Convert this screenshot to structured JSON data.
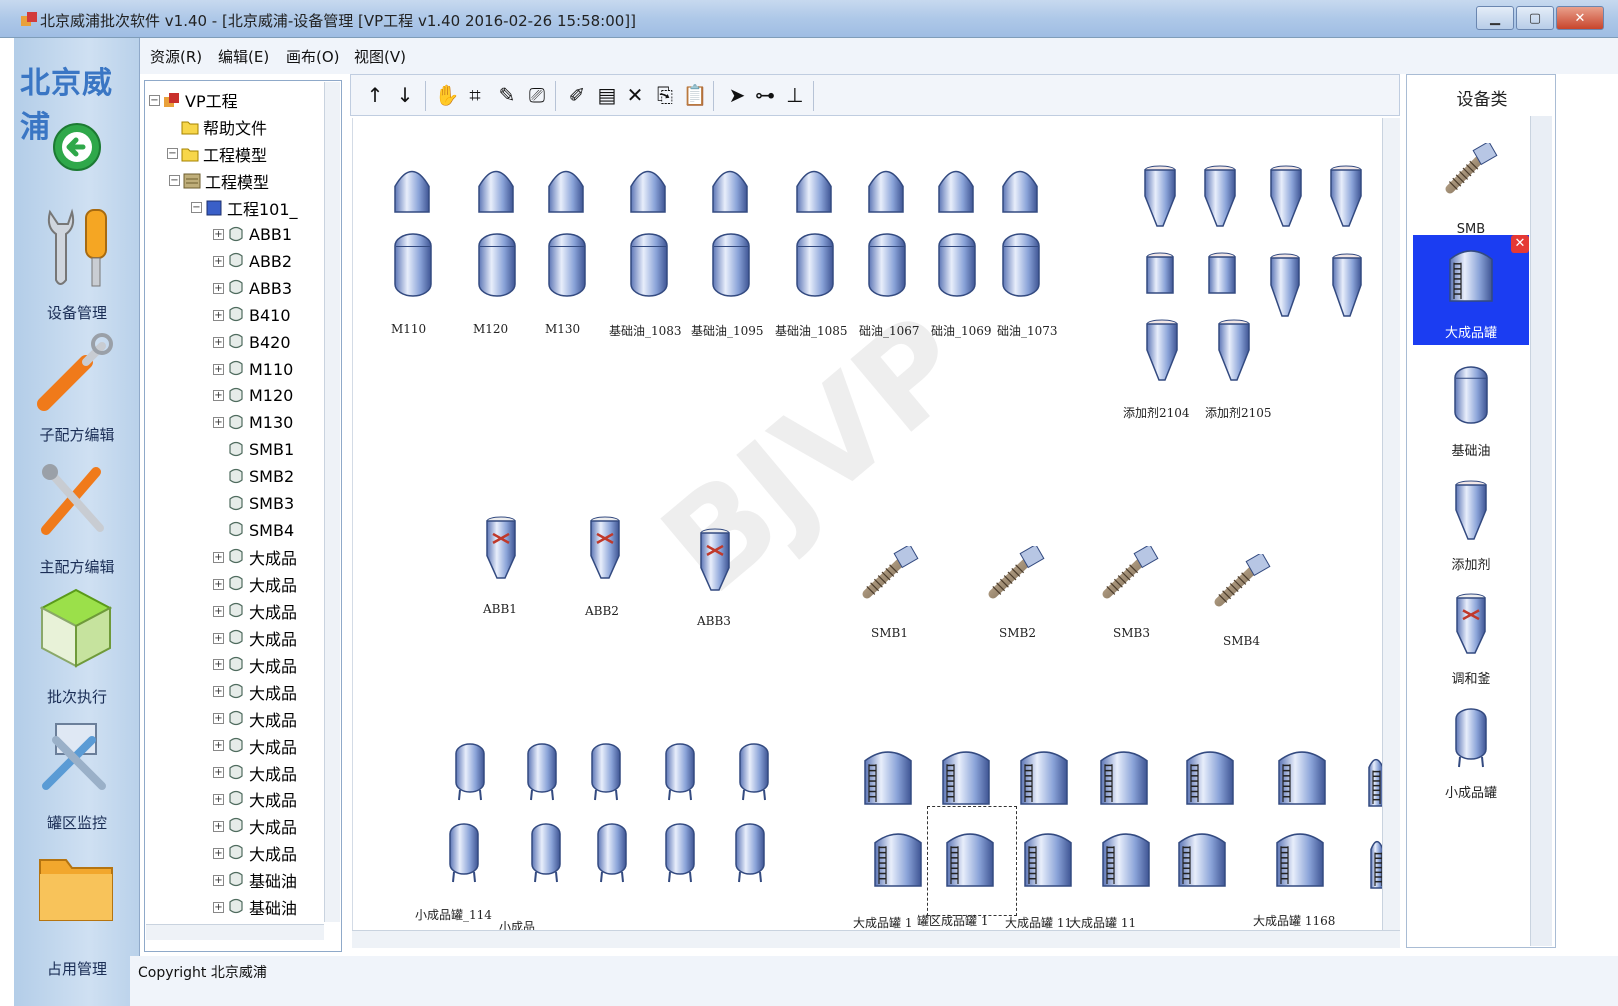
{
  "window": {
    "title": "北京威浦批次软件 v1.40 - [北京威浦-设备管理 [VP工程 v1.40 2016-02-26 15:58:00]]"
  },
  "menu": [
    {
      "label": "资源(R)"
    },
    {
      "label": "编辑(E)"
    },
    {
      "label": "画布(O)"
    },
    {
      "label": "视图(V)"
    }
  ],
  "sidebar": {
    "brand": "北京威浦",
    "items": [
      {
        "label": "设备管理",
        "icon": "wrench-screwdriver-icon"
      },
      {
        "label": "子配方编辑",
        "icon": "tools-icon"
      },
      {
        "label": "主配方编辑",
        "icon": "crossed-tools-icon"
      },
      {
        "label": "批次执行",
        "icon": "cubes-icon"
      },
      {
        "label": "罐区监控",
        "icon": "monitor-tools-icon"
      },
      {
        "label": "占用管理",
        "icon": "folder-icon"
      }
    ]
  },
  "tree": {
    "rows": [
      {
        "label": "VP工程",
        "level": 0,
        "exp": "⊟"
      },
      {
        "label": "帮助文件",
        "level": 1,
        "exp": ""
      },
      {
        "label": "工程模型",
        "level": 1,
        "exp": "⊟"
      },
      {
        "label": "工程模型",
        "level": 2,
        "exp": "⊟"
      },
      {
        "label": "工程101_",
        "level": 3,
        "exp": "⊟"
      },
      {
        "label": "ABB1",
        "level": 4,
        "exp": "⊞"
      },
      {
        "label": "ABB2",
        "level": 4,
        "exp": "⊞"
      },
      {
        "label": "ABB3",
        "level": 4,
        "exp": "⊞"
      },
      {
        "label": "B410",
        "level": 4,
        "exp": "⊞"
      },
      {
        "label": "B420",
        "level": 4,
        "exp": "⊞"
      },
      {
        "label": "M110",
        "level": 4,
        "exp": "⊞"
      },
      {
        "label": "M120",
        "level": 4,
        "exp": "⊞"
      },
      {
        "label": "M130",
        "level": 4,
        "exp": "⊞"
      },
      {
        "label": "SMB1",
        "level": 4,
        "exp": ""
      },
      {
        "label": "SMB2",
        "level": 4,
        "exp": ""
      },
      {
        "label": "SMB3",
        "level": 4,
        "exp": ""
      },
      {
        "label": "SMB4",
        "level": 4,
        "exp": ""
      },
      {
        "label": "大成品",
        "level": 4,
        "exp": "⊞"
      },
      {
        "label": "大成品",
        "level": 4,
        "exp": "⊞"
      },
      {
        "label": "大成品",
        "level": 4,
        "exp": "⊞"
      },
      {
        "label": "大成品",
        "level": 4,
        "exp": "⊞"
      },
      {
        "label": "大成品",
        "level": 4,
        "exp": "⊞"
      },
      {
        "label": "大成品",
        "level": 4,
        "exp": "⊞"
      },
      {
        "label": "大成品",
        "level": 4,
        "exp": "⊞"
      },
      {
        "label": "大成品",
        "level": 4,
        "exp": "⊞"
      },
      {
        "label": "大成品",
        "level": 4,
        "exp": "⊞"
      },
      {
        "label": "大成品",
        "level": 4,
        "exp": "⊞"
      },
      {
        "label": "大成品",
        "level": 4,
        "exp": "⊞"
      },
      {
        "label": "大成品",
        "level": 4,
        "exp": "⊞"
      },
      {
        "label": "基础油",
        "level": 4,
        "exp": "⊞"
      },
      {
        "label": "基础油",
        "level": 4,
        "exp": "⊞"
      }
    ]
  },
  "toolbar": {
    "buttons": [
      {
        "glyph": "↑",
        "name": "move-up-icon"
      },
      {
        "glyph": "↓",
        "name": "move-down-icon"
      },
      {
        "glyph": "✋",
        "name": "hand-icon"
      },
      {
        "glyph": "⌗",
        "name": "grid-icon"
      },
      {
        "glyph": "✎",
        "name": "edit-icon"
      },
      {
        "glyph": "⎚",
        "name": "clear-icon"
      },
      {
        "glyph": "✐",
        "name": "properties-icon"
      },
      {
        "glyph": "▤",
        "name": "new-icon"
      },
      {
        "glyph": "✕",
        "name": "delete-icon"
      },
      {
        "glyph": "⎘",
        "name": "copy-icon"
      },
      {
        "glyph": "📋",
        "name": "paste-icon"
      },
      {
        "glyph": "➤",
        "name": "pointer-icon"
      },
      {
        "glyph": "⊶",
        "name": "connect-icon"
      },
      {
        "glyph": "⊥",
        "name": "align-icon"
      }
    ]
  },
  "canvas": {
    "labels": {
      "m110": "M110",
      "m120": "M120",
      "m130": "M130",
      "jc1083": "基础油_1083",
      "jc1095": "基础油_1095",
      "jc1085": "基础油_1085",
      "jc1067": "础油_1067",
      "jc1069": "础油_1069",
      "jc1073": "础油_1073",
      "tjj2104": "添加剂2104",
      "tjj2105": "添加剂2105",
      "abb1": "ABB1",
      "abb2": "ABB2",
      "abb3": "ABB3",
      "smb1": "SMB1",
      "smb2": "SMB2",
      "smb3": "SMB3",
      "smb4": "SMB4",
      "xcp114": "小成品罐_114",
      "xcp_trunc": "小成品",
      "dcp_a": "大成品罐 1",
      "dcp_b": "罐区成品罐 1",
      "dcp_c": "大成品罐 11",
      "dcp_d": "大成品罐 11",
      "dcp_1168": "大成品罐 1168"
    }
  },
  "palette": {
    "title": "设备类",
    "items": [
      {
        "label": "SMB",
        "icon": "screw-conveyor-icon",
        "selected": false
      },
      {
        "label": "大成品罐",
        "icon": "large-tank-icon",
        "selected": true
      },
      {
        "label": "基础油",
        "icon": "base-oil-tank-icon",
        "selected": false
      },
      {
        "label": "添加剂",
        "icon": "additive-hopper-icon",
        "selected": false
      },
      {
        "label": "调和釜",
        "icon": "mixer-kettle-icon",
        "selected": false
      },
      {
        "label": "小成品罐",
        "icon": "small-tank-icon",
        "selected": false
      }
    ]
  },
  "status": {
    "copyright": "Copyright 北京威浦"
  },
  "watermark": "BJVP",
  "colors": {
    "accent": "#1b3df2",
    "tank_top": "#dfe7f5",
    "tank_body": "#7a95cf"
  }
}
